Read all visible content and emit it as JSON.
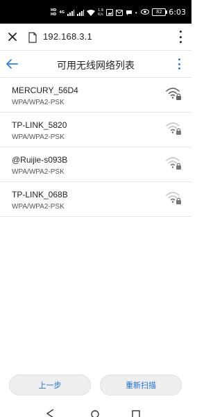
{
  "status_bar": {
    "hd_label": "HD",
    "signal_label": "4G",
    "speed_value": "1.9",
    "speed_unit": "K/s",
    "battery": "82",
    "time": "6:03"
  },
  "browser": {
    "url": "192.168.3.1"
  },
  "header": {
    "title": "可用无线网络列表"
  },
  "networks": [
    {
      "ssid": "MERCURY_56D4",
      "security": "WPA/WPA2-PSK",
      "signal": "strong"
    },
    {
      "ssid": "TP-LINK_5820",
      "security": "WPA/WPA2-PSK",
      "signal": "weak"
    },
    {
      "ssid": "@Ruijie-s093B",
      "security": "WPA/WPA2-PSK",
      "signal": "weak"
    },
    {
      "ssid": "TP-LINK_068B",
      "security": "WPA/WPA2-PSK",
      "signal": "weak"
    }
  ],
  "buttons": {
    "prev_label": "上一步",
    "rescan_label": "重新扫描"
  },
  "colors": {
    "accent": "#2e7de6",
    "button_text": "#1f6fd6",
    "button_bg": "#eeeeee",
    "divider": "#e6e6e6"
  }
}
